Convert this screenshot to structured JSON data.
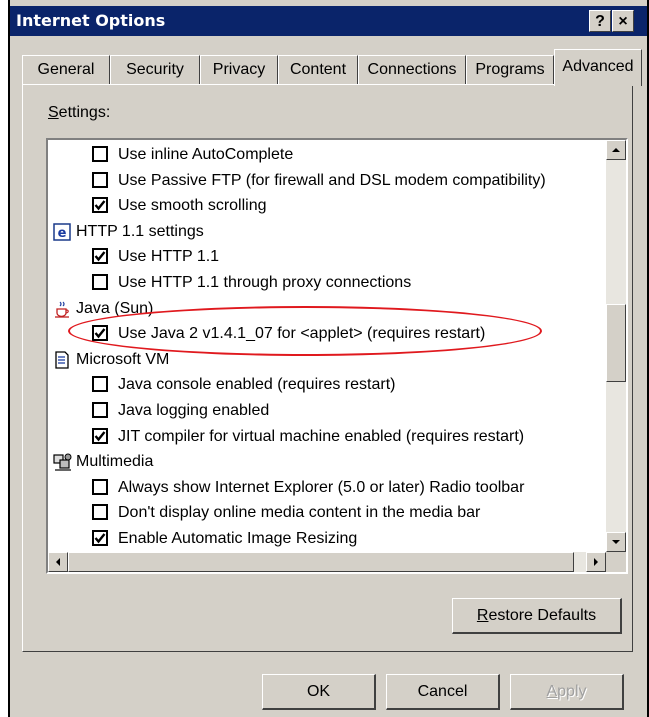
{
  "window": {
    "title": "Internet Options",
    "help_label": "?",
    "close_label": "×"
  },
  "tabs": [
    {
      "label": "General",
      "active": false
    },
    {
      "label": "Security",
      "active": false
    },
    {
      "label": "Privacy",
      "active": false
    },
    {
      "label": "Content",
      "active": false
    },
    {
      "label": "Connections",
      "active": false
    },
    {
      "label": "Programs",
      "active": false
    },
    {
      "label": "Advanced",
      "active": true
    }
  ],
  "settings": {
    "label_first": "S",
    "label_rest": "ettings:",
    "rows": [
      {
        "kind": "option",
        "label": "Use inline AutoComplete",
        "checked": false
      },
      {
        "kind": "option",
        "label": "Use Passive FTP (for firewall and DSL modem compatibility)",
        "checked": false
      },
      {
        "kind": "option",
        "label": "Use smooth scrolling",
        "checked": true
      },
      {
        "kind": "category",
        "label": "HTTP 1.1 settings",
        "icon": "ie-settings-icon"
      },
      {
        "kind": "option",
        "label": "Use HTTP 1.1",
        "checked": true
      },
      {
        "kind": "option",
        "label": "Use HTTP 1.1 through proxy connections",
        "checked": false
      },
      {
        "kind": "category",
        "label": "Java (Sun)",
        "icon": "java-coffee-icon"
      },
      {
        "kind": "option",
        "label": "Use Java 2 v1.4.1_07 for <applet> (requires restart)",
        "checked": true
      },
      {
        "kind": "category",
        "label": "Microsoft VM",
        "icon": "document-icon"
      },
      {
        "kind": "option",
        "label": "Java console enabled (requires restart)",
        "checked": false
      },
      {
        "kind": "option",
        "label": "Java logging enabled",
        "checked": false
      },
      {
        "kind": "option",
        "label": "JIT compiler for virtual machine enabled (requires restart)",
        "checked": true
      },
      {
        "kind": "category",
        "label": "Multimedia",
        "icon": "multimedia-icon"
      },
      {
        "kind": "option",
        "label": "Always show Internet Explorer (5.0 or later) Radio toolbar",
        "checked": false
      },
      {
        "kind": "option",
        "label": "Don't display online media content in the media bar",
        "checked": false
      },
      {
        "kind": "option",
        "label": "Enable Automatic Image Resizing",
        "checked": true
      }
    ]
  },
  "buttons": {
    "restore_first": "R",
    "restore_rest": "estore Defaults",
    "ok": "OK",
    "cancel": "Cancel",
    "apply_first": "A",
    "apply_rest": "pply"
  },
  "colors": {
    "titlebar": "#0a246a",
    "face": "#d4d0c8",
    "highlight_ellipse": "#e0191e"
  }
}
